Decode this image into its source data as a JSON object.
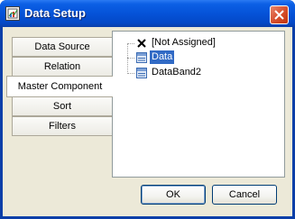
{
  "window": {
    "title": "Data Setup",
    "title_icon": "data-setup-icon",
    "close_icon": "close-icon"
  },
  "tabs": [
    {
      "label": "Data Source",
      "active": false
    },
    {
      "label": "Relation",
      "active": false
    },
    {
      "label": "Master Component",
      "active": true
    },
    {
      "label": "Sort",
      "active": false
    },
    {
      "label": "Filters",
      "active": false
    }
  ],
  "tree": {
    "items": [
      {
        "label": "[Not Assigned]",
        "icon": "x-icon",
        "selected": false
      },
      {
        "label": "Data",
        "icon": "data-band-icon",
        "selected": true
      },
      {
        "label": "DataBand2",
        "icon": "data-band-icon",
        "selected": false
      }
    ]
  },
  "buttons": {
    "ok_label": "OK",
    "cancel_label": "Cancel"
  },
  "colors": {
    "titlebar": "#0553d8",
    "selection": "#316ac5",
    "dialog_bg": "#ece9d8"
  }
}
